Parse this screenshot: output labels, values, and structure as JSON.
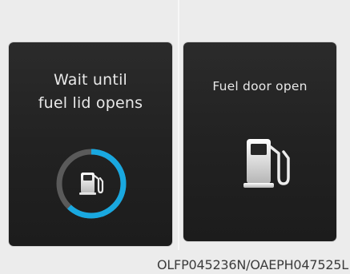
{
  "left_panel": {
    "message_line1": "Wait until",
    "message_line2": "fuel lid opens",
    "progress": 0.62,
    "ring_track_color": "#5a5a5a",
    "ring_progress_color": "#19a8e0",
    "icon": "fuel-pump-icon"
  },
  "right_panel": {
    "message": "Fuel door open",
    "icon": "fuel-pump-icon"
  },
  "image_code": "OLFP045236N/OAEPH047525L"
}
